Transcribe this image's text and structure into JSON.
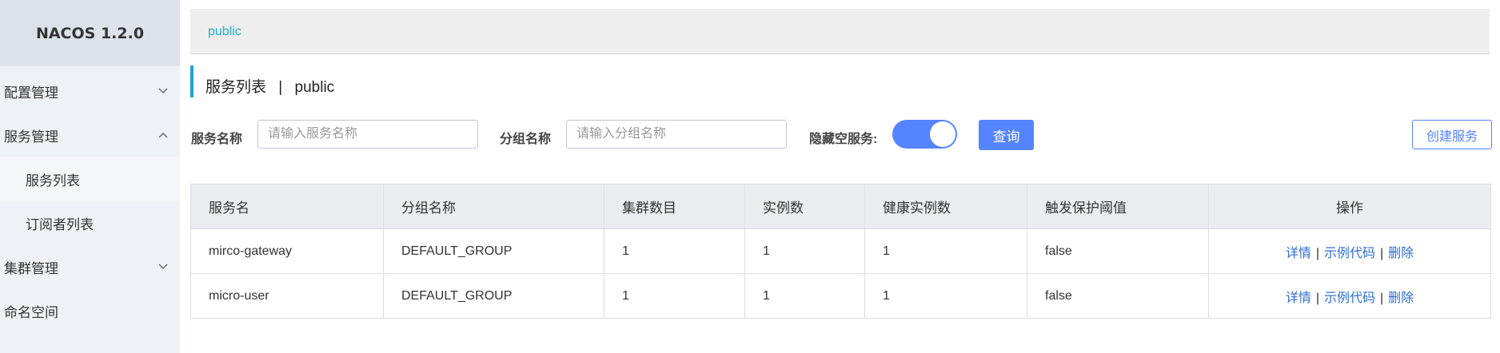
{
  "app": {
    "brand": "NACOS 1.2.0"
  },
  "sidebar": {
    "items": [
      {
        "label": "配置管理"
      },
      {
        "label": "服务管理"
      },
      {
        "label": "服务列表"
      },
      {
        "label": "订阅者列表"
      },
      {
        "label": "集群管理"
      },
      {
        "label": "命名空间"
      }
    ]
  },
  "breadcrumb": {
    "namespace": "public"
  },
  "page": {
    "title": "服务列表",
    "separator": "|",
    "namespace": "public"
  },
  "filters": {
    "service_name_label": "服务名称",
    "service_name_placeholder": "请输入服务名称",
    "service_name_value": "",
    "group_name_label": "分组名称",
    "group_name_placeholder": "请输入分组名称",
    "group_name_value": "",
    "hide_empty_label": "隐藏空服务:",
    "hide_empty_on": true,
    "query_label": "查询",
    "create_label": "创建服务"
  },
  "table": {
    "columns": [
      "服务名",
      "分组名称",
      "集群数目",
      "实例数",
      "健康实例数",
      "触发保护阈值",
      "操作"
    ],
    "rows": [
      {
        "name": "mirco-gateway",
        "group": "DEFAULT_GROUP",
        "clusters": "1",
        "instances": "1",
        "healthy": "1",
        "threshold": "false",
        "op_detail": "详情",
        "op_sep1": "|",
        "op_sample": "示例代码",
        "op_sep2": "|",
        "op_delete": "删除"
      },
      {
        "name": "micro-user",
        "group": "DEFAULT_GROUP",
        "clusters": "1",
        "instances": "1",
        "healthy": "1",
        "threshold": "false",
        "op_detail": "详情",
        "op_sep1": "|",
        "op_sample": "示例代码",
        "op_sep2": "|",
        "op_delete": "删除"
      }
    ]
  },
  "colors": {
    "accent": "#5584ff",
    "link": "#2e6fd6",
    "breadcrumb": "#1fb1c9"
  }
}
